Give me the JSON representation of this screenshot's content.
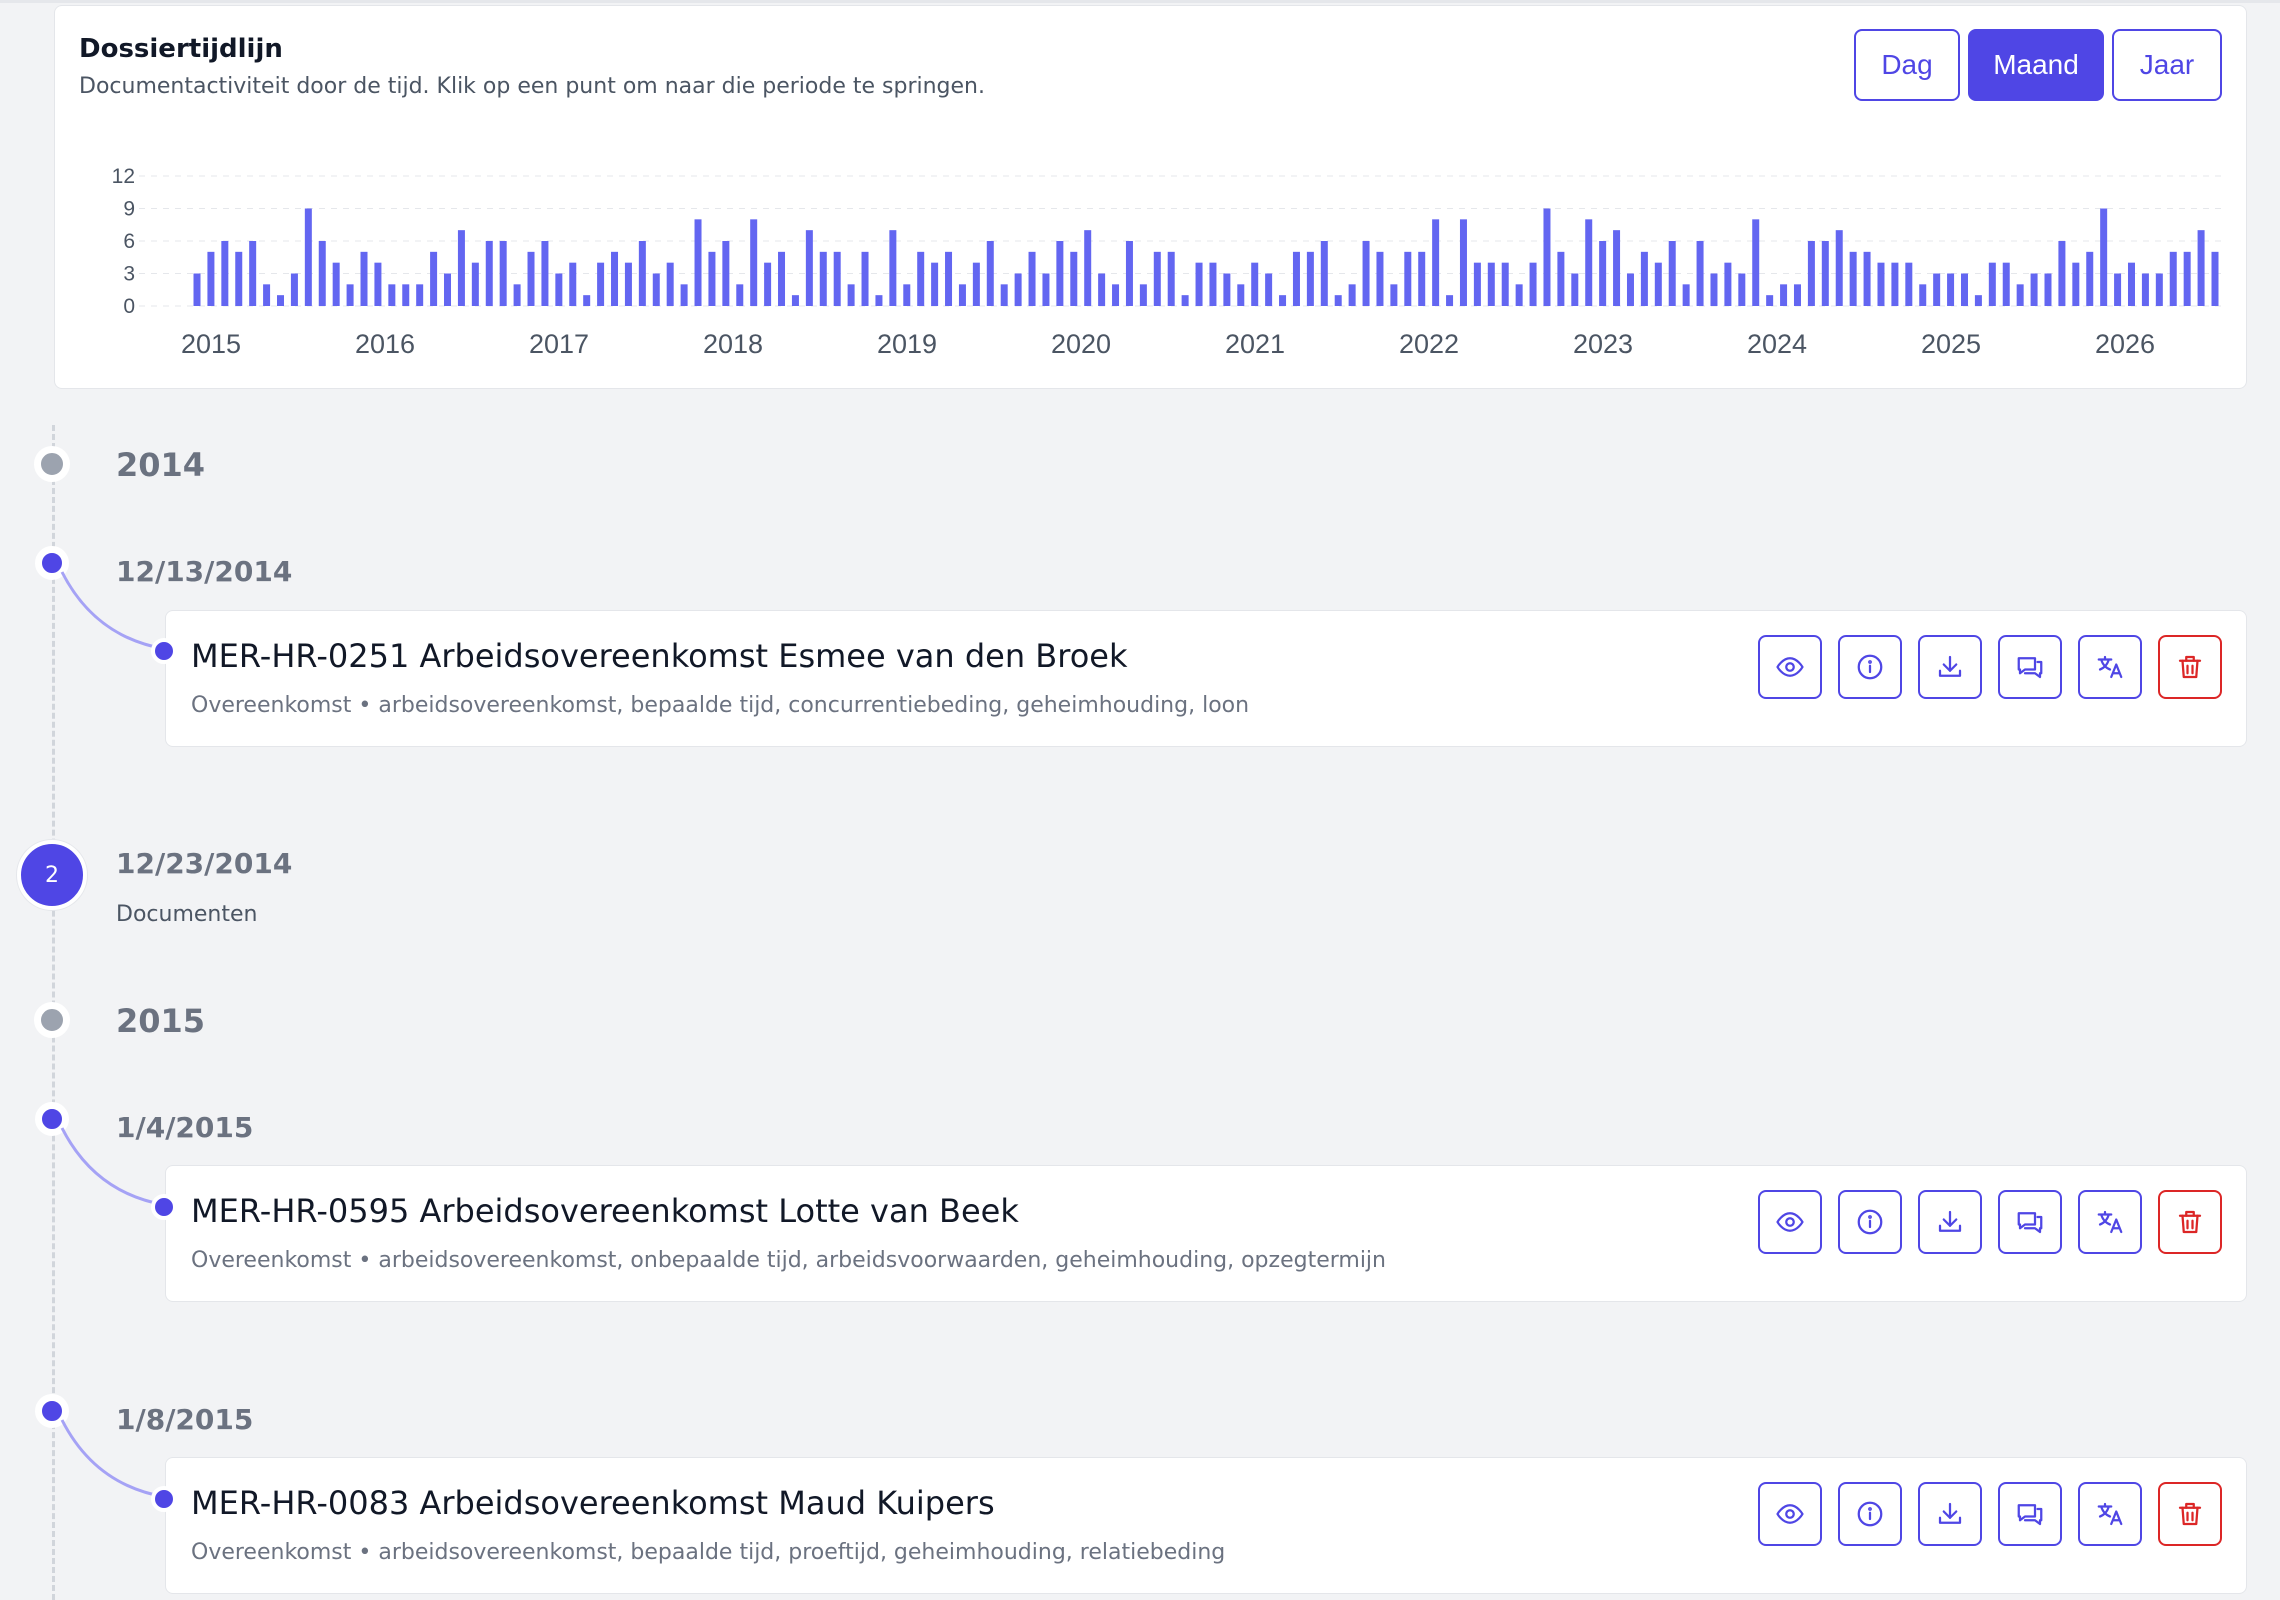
{
  "timeline_card": {
    "title": "Dossiertijdlijn",
    "subtitle": "Documentactiviteit door de tijd. Klik op een punt om naar die periode te springen.",
    "granularity": [
      "Dag",
      "Maand",
      "Jaar"
    ],
    "active_granularity": "Maand"
  },
  "colors": {
    "accent": "#4f46e5",
    "bar": "#6366f1",
    "danger": "#dc2626",
    "muted": "#9ca3af"
  },
  "chart_data": {
    "type": "bar",
    "x_tick_labels": [
      "2015",
      "2016",
      "2017",
      "2018",
      "2019",
      "2020",
      "2021",
      "2022",
      "2023",
      "2024",
      "2025",
      "2026"
    ],
    "y_ticks": [
      0,
      3,
      6,
      9,
      12
    ],
    "ylim": [
      0,
      12
    ],
    "grid": true,
    "values": [
      3,
      5,
      6,
      5,
      6,
      2,
      1,
      3,
      9,
      6,
      4,
      2,
      5,
      4,
      2,
      2,
      2,
      5,
      3,
      7,
      4,
      6,
      6,
      2,
      5,
      6,
      3,
      4,
      1,
      4,
      5,
      4,
      6,
      3,
      4,
      2,
      8,
      5,
      6,
      2,
      8,
      4,
      5,
      1,
      7,
      5,
      5,
      2,
      5,
      1,
      7,
      2,
      5,
      4,
      5,
      2,
      4,
      6,
      2,
      3,
      5,
      3,
      6,
      5,
      7,
      3,
      2,
      6,
      2,
      5,
      5,
      1,
      4,
      4,
      3,
      2,
      4,
      3,
      1,
      5,
      5,
      6,
      1,
      2,
      6,
      5,
      2,
      5,
      5,
      8,
      1,
      8,
      4,
      4,
      4,
      2,
      4,
      9,
      5,
      3,
      8,
      6,
      7,
      3,
      5,
      4,
      6,
      2,
      6,
      3,
      4,
      3,
      8,
      1,
      2,
      2,
      6,
      6,
      7,
      5,
      5,
      4,
      4,
      4,
      2,
      3,
      3,
      3,
      1,
      4,
      4,
      2,
      3,
      3,
      6,
      4,
      5,
      9,
      3,
      4,
      3,
      3,
      5,
      5,
      7,
      5
    ]
  },
  "timeline": {
    "years": [
      "2014",
      "2015"
    ],
    "dates": [
      "12/13/2014",
      "12/23/2014",
      "1/4/2015",
      "1/8/2015"
    ],
    "group_count": "2",
    "group_sub": "Documenten",
    "docs": [
      {
        "title": "MER-HR-0251 Arbeidsovereenkomst Esmee van den Broek",
        "meta": "Overeenkomst • arbeidsovereenkomst, bepaalde tijd, concurrentiebeding, geheimhouding, loon"
      },
      {
        "title": "MER-HR-0595 Arbeidsovereenkomst Lotte van Beek",
        "meta": "Overeenkomst • arbeidsovereenkomst, onbepaalde tijd, arbeidsvoorwaarden, geheimhouding, opzegtermijn"
      },
      {
        "title": "MER-HR-0083 Arbeidsovereenkomst Maud Kuipers",
        "meta": "Overeenkomst • arbeidsovereenkomst, bepaalde tijd, proeftijd, geheimhouding, relatiebeding"
      }
    ],
    "action_icons": [
      "eye-icon",
      "info-icon",
      "download-icon",
      "chat-icon",
      "translate-icon",
      "trash-icon"
    ]
  }
}
